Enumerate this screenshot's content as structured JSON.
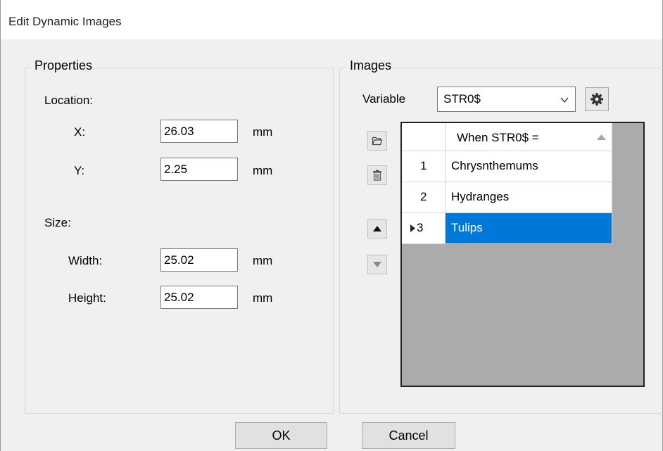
{
  "window": {
    "title": "Edit Dynamic Images"
  },
  "properties": {
    "legend": "Properties",
    "location_label": "Location:",
    "x_label": "X:",
    "x_value": "26.03",
    "y_label": "Y:",
    "y_value": "2.25",
    "size_label": "Size:",
    "width_label": "Width:",
    "width_value": "25.02",
    "height_label": "Height:",
    "height_value": "25.02",
    "unit": "mm"
  },
  "images": {
    "legend": "Images",
    "variable_label": "Variable",
    "variable_value": "STR0$",
    "grid": {
      "column_header": "When STR0$ =",
      "rows": [
        {
          "num": "1",
          "value": "Chrysnthemums"
        },
        {
          "num": "2",
          "value": "Hydranges"
        },
        {
          "num": "3",
          "value": "Tulips",
          "selected": true
        }
      ]
    }
  },
  "buttons": {
    "ok": "OK",
    "cancel": "Cancel"
  },
  "icons": {
    "settings": "gear-icon",
    "open": "folder-open-icon",
    "delete": "trash-icon",
    "up": "arrow-up-icon",
    "down": "arrow-down-icon",
    "dropdown": "chevron-down-icon",
    "sort": "sort-ascending-icon",
    "current_row": "row-indicator-icon"
  },
  "colors": {
    "selection": "#0078d7",
    "grid_background": "#ababab"
  }
}
